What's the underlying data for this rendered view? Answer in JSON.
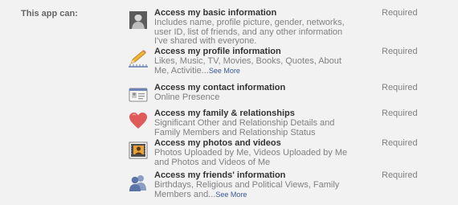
{
  "section_label": "This app can:",
  "required_label": "Required",
  "see_more_label": "See More",
  "permissions": [
    {
      "title": "Access my basic information",
      "description": "Includes name, profile picture, gender, networks, user ID, list of friends, and any other information I've shared with everyone.",
      "icon": "avatar-icon"
    },
    {
      "title": "Access my profile information",
      "description": "Likes, Music, TV, Movies, Books, Quotes, About Me, Activitie...",
      "icon": "pencil-icon"
    },
    {
      "title": "Access my contact information",
      "description": "Online Presence",
      "icon": "contact-card-icon"
    },
    {
      "title": "Access my family & relationships",
      "description": "Significant Other and Relationship Details and Family Members and Relationship Status",
      "icon": "heart-icon"
    },
    {
      "title": "Access my photos and videos",
      "description": "Photos Uploaded by Me, Videos Uploaded by Me and Photos and Videos of Me",
      "icon": "photos-icon"
    },
    {
      "title": "Access my friends' information",
      "description": "Birthdays, Religious and Political Views, Family Members and...",
      "icon": "friends-icon"
    }
  ]
}
